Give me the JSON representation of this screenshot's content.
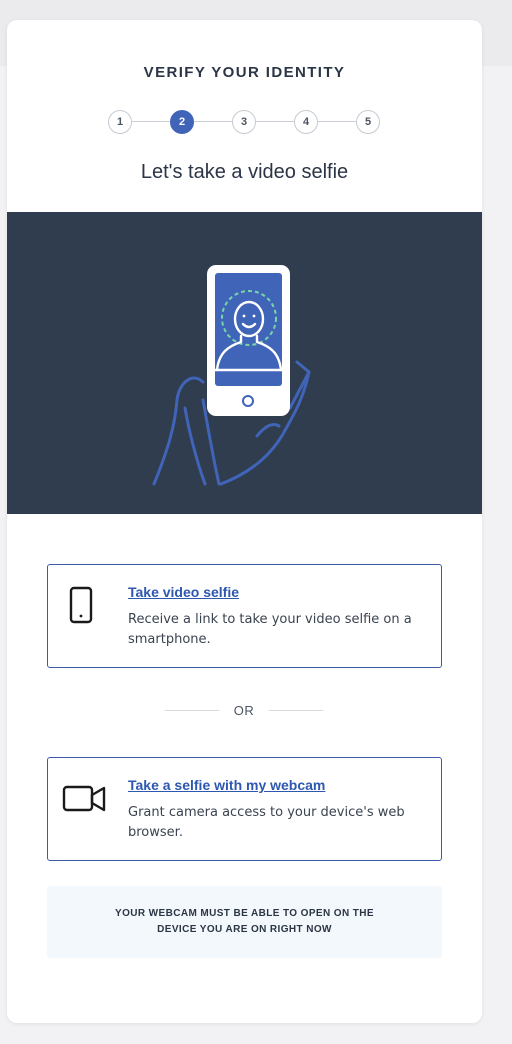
{
  "header": {
    "title": "VERIFY YOUR IDENTITY",
    "steps": [
      "1",
      "2",
      "3",
      "4",
      "5"
    ],
    "active_step": "2"
  },
  "subtitle": "Let's take a video selfie",
  "hero": {
    "illustration": "hand-holding-phone-face-scan",
    "colors": {
      "background": "#303d4f",
      "accent": "#3f64b8",
      "scan": "#7ad3a8"
    }
  },
  "options": [
    {
      "icon": "smartphone-icon",
      "title": "Take video selfie",
      "description": "Receive a link to take your video selfie on a smartphone."
    },
    {
      "icon": "video-camera-icon",
      "title": "Take a selfie with my webcam",
      "description": "Grant camera access to your device's web browser."
    }
  ],
  "divider_text": "OR",
  "notice": "YOUR WEBCAM MUST BE ABLE TO OPEN ON THE DEVICE YOU ARE ON RIGHT NOW",
  "colors": {
    "accent": "#3f64b8",
    "link": "#2e57b0",
    "text": "#2b3545",
    "notice_bg": "#f3f8fc"
  }
}
